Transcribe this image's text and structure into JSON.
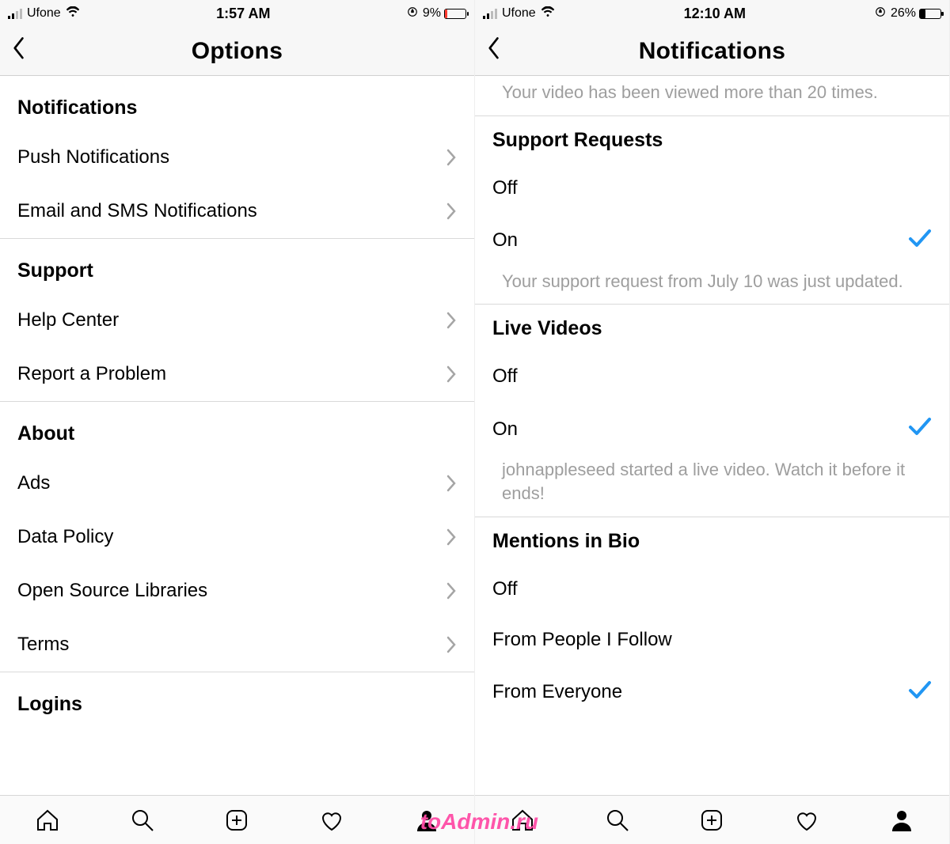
{
  "watermark": "toAdmin.ru",
  "left": {
    "status": {
      "carrier": "Ufone",
      "time": "1:57 AM",
      "battery_pct": "9%"
    },
    "nav": {
      "title": "Options"
    },
    "sections": {
      "notifications": {
        "header": "Notifications",
        "items": [
          "Push Notifications",
          "Email and SMS Notifications"
        ]
      },
      "support": {
        "header": "Support",
        "items": [
          "Help Center",
          "Report a Problem"
        ]
      },
      "about": {
        "header": "About",
        "items": [
          "Ads",
          "Data Policy",
          "Open Source Libraries",
          "Terms"
        ]
      },
      "logins": {
        "header": "Logins"
      }
    }
  },
  "right": {
    "status": {
      "carrier": "Ufone",
      "time": "12:10 AM",
      "battery_pct": "26%"
    },
    "nav": {
      "title": "Notifications"
    },
    "lead_text": "Your video has been viewed more than 20 times.",
    "groups": {
      "support_requests": {
        "header": "Support Requests",
        "off": "Off",
        "on": "On",
        "note": "Your support request from July 10 was just updated."
      },
      "live_videos": {
        "header": "Live Videos",
        "off": "Off",
        "on": "On",
        "note": "johnappleseed started a live video. Watch it before it ends!"
      },
      "mentions": {
        "header": "Mentions in Bio",
        "opt_off": "Off",
        "opt_follow": "From People I Follow",
        "opt_everyone": "From Everyone"
      }
    }
  }
}
